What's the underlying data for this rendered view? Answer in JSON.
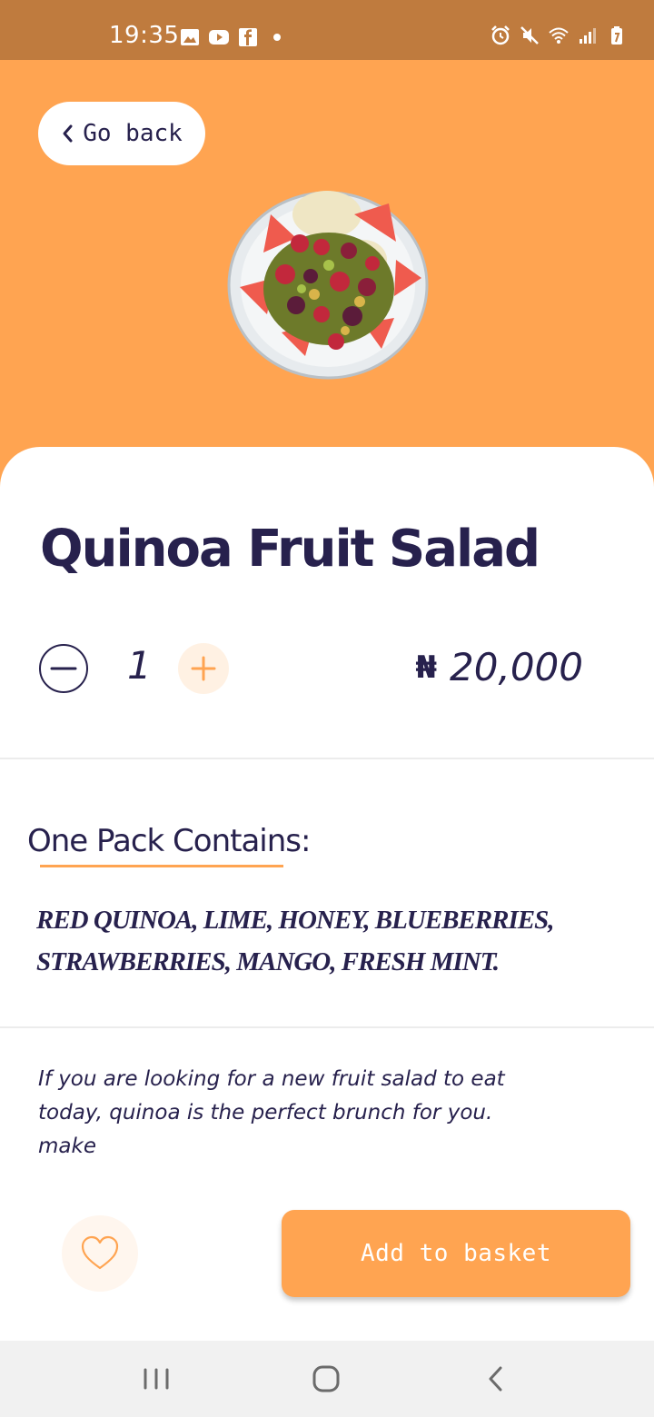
{
  "status_bar": {
    "time": "19:35",
    "left_icons": [
      "gallery-icon",
      "youtube-icon",
      "facebook-icon",
      "dot-icon"
    ],
    "right_icons": [
      "alarm-icon",
      "mute-icon",
      "wifi-icon",
      "signal-icon",
      "battery-icon"
    ]
  },
  "header": {
    "back_label": "Go back",
    "background_color": "#ffa451"
  },
  "product": {
    "title": "Quinoa Fruit Salad",
    "quantity": "1",
    "currency_symbol": "₦",
    "price": "20,000",
    "image_icon": "fruit-salad-plate"
  },
  "contents": {
    "heading": "One Pack Contains:",
    "ingredients_line1": "RED QUINOA, LIME, HONEY, BLUEBERRIES,",
    "ingredients_line2": "STRAWBERRIES, MANGO, FRESH MINT.",
    "description_line1": "If you are looking for a new fruit salad to eat",
    "description_line2": "today, quinoa is the perfect brunch for you.",
    "description_line3": "make"
  },
  "actions": {
    "favorite_icon": "heart-icon",
    "add_label": "Add to basket",
    "accent_color": "#ffa451",
    "text_color": "#27214d"
  },
  "nav": {
    "icons": [
      "recents-icon",
      "home-icon",
      "back-icon"
    ]
  }
}
